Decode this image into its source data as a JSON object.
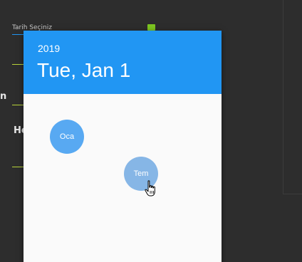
{
  "background": {
    "field_label": "Tarih Seçiniz",
    "left_fragment_1": "n",
    "left_fragment_2": "He"
  },
  "dialog": {
    "header": {
      "year": "2019",
      "date": "Tue, Jan 1"
    },
    "months": [
      {
        "label": "Oca",
        "state": "selected"
      },
      {
        "label": "Tem",
        "state": "hover"
      }
    ]
  },
  "colors": {
    "header": "#2196f3",
    "selected_month": "#58a9f2",
    "hover_month": "#86b6e6",
    "dialog_body": "#fafafa",
    "background": "#2d2d2d",
    "calendar_icon": "#7cc520"
  },
  "icons": {
    "calendar": "calendar-icon",
    "cursor": "hand-pointer-icon"
  }
}
